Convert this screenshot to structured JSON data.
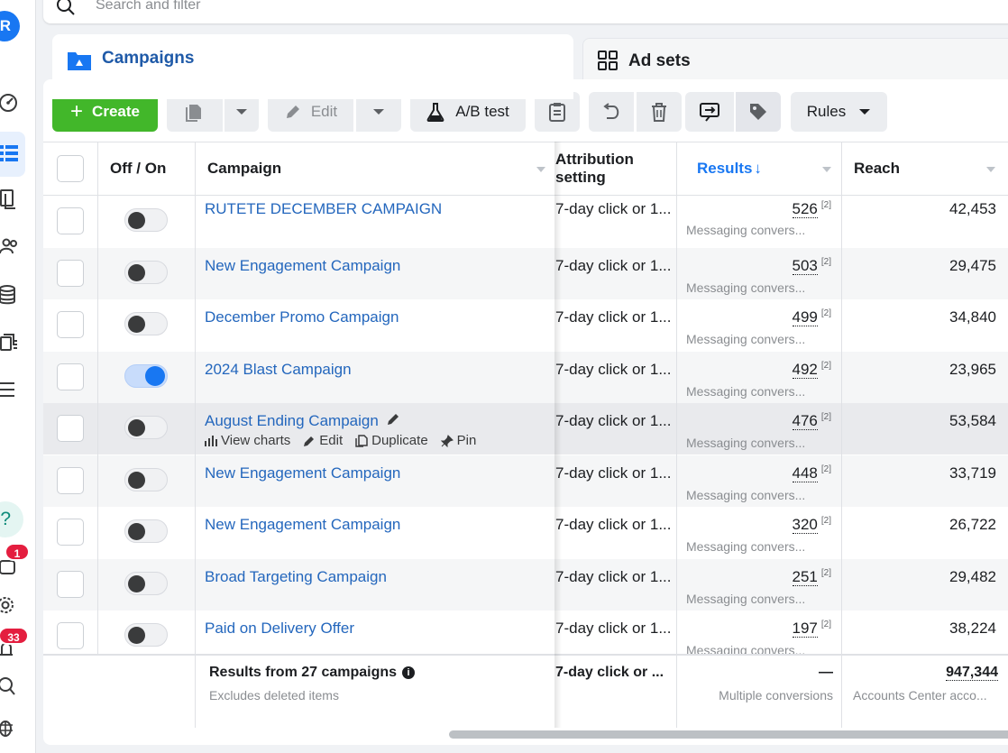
{
  "rail": {
    "avatar_letter": "R",
    "help_glyph": "?",
    "notif_badge": "1",
    "alerts_badge": "33"
  },
  "search": {
    "placeholder": "Search and filter"
  },
  "tabs": {
    "campaigns": "Campaigns",
    "adsets": "Ad sets"
  },
  "toolbar": {
    "create": "Create",
    "edit": "Edit",
    "abtest": "A/B test",
    "rules": "Rules"
  },
  "columns": {
    "offon": "Off / On",
    "campaign": "Campaign",
    "attribution": "Attribution setting",
    "results": "Results",
    "reach": "Reach"
  },
  "rows": [
    {
      "name": "RUTETE DECEMBER CAMPAIGN",
      "on": false,
      "attribution": "7-day click or 1...",
      "results": "526",
      "results_note": "[2]",
      "results_sub": "Messaging convers...",
      "reach": "42,453"
    },
    {
      "name": "New Engagement Campaign",
      "on": false,
      "attribution": "7-day click or 1...",
      "results": "503",
      "results_note": "[2]",
      "results_sub": "Messaging convers...",
      "reach": "29,475"
    },
    {
      "name": "December Promo Campaign",
      "on": false,
      "attribution": "7-day click or 1...",
      "results": "499",
      "results_note": "[2]",
      "results_sub": "Messaging convers...",
      "reach": "34,840"
    },
    {
      "name": "2024 Blast Campaign",
      "on": true,
      "attribution": "7-day click or 1...",
      "results": "492",
      "results_note": "[2]",
      "results_sub": "Messaging convers...",
      "reach": "23,965"
    },
    {
      "name": "August Ending Campaign",
      "on": false,
      "attribution": "7-day click or 1...",
      "results": "476",
      "results_note": "[2]",
      "results_sub": "Messaging convers...",
      "reach": "53,584"
    },
    {
      "name": "New Engagement Campaign",
      "on": false,
      "attribution": "7-day click or 1...",
      "results": "448",
      "results_note": "[2]",
      "results_sub": "Messaging convers...",
      "reach": "33,719"
    },
    {
      "name": "New Engagement Campaign",
      "on": false,
      "attribution": "7-day click or 1...",
      "results": "320",
      "results_note": "[2]",
      "results_sub": "Messaging convers...",
      "reach": "26,722"
    },
    {
      "name": "Broad Targeting Campaign",
      "on": false,
      "attribution": "7-day click or 1...",
      "results": "251",
      "results_note": "[2]",
      "results_sub": "Messaging convers...",
      "reach": "29,482"
    },
    {
      "name": "Paid on Delivery Offer",
      "on": false,
      "attribution": "7-day click or 1...",
      "results": "197",
      "results_note": "[2]",
      "results_sub": "Messaging convers...",
      "reach": "38,224"
    }
  ],
  "row_actions": {
    "view_charts": "View charts",
    "edit": "Edit",
    "duplicate": "Duplicate",
    "pin": "Pin"
  },
  "footer": {
    "title": "Results from 27 campaigns",
    "subtitle": "Excludes deleted items",
    "attribution": "7-day click or ...",
    "results": "—",
    "results_sub": "Multiple conversions",
    "reach": "947,344",
    "reach_sub": "Accounts Center acco..."
  }
}
